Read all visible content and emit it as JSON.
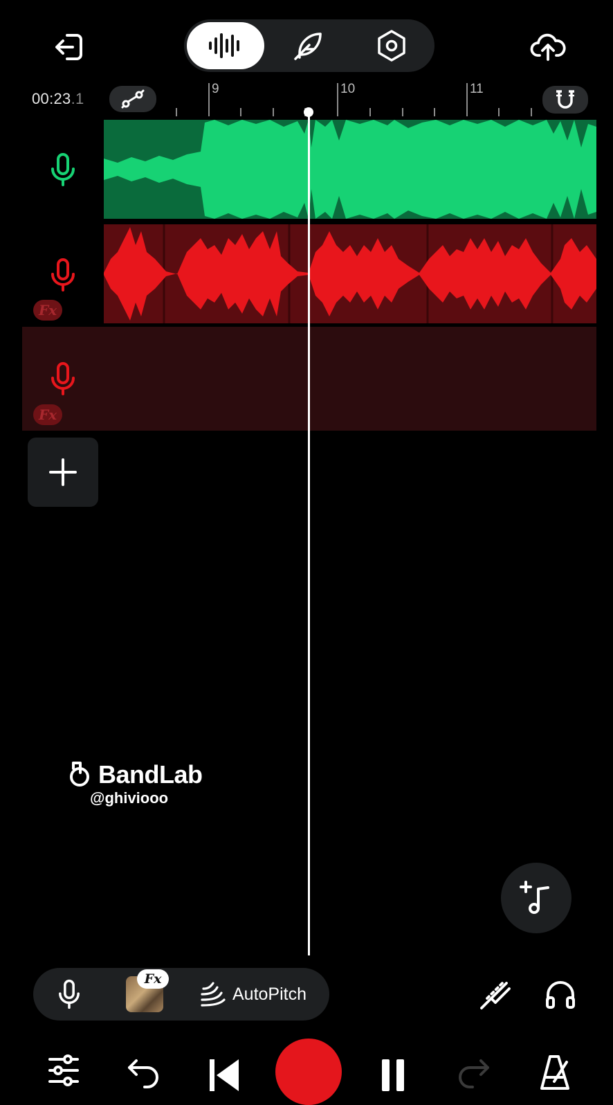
{
  "header": {
    "modes": [
      {
        "name": "tracks",
        "active": true
      },
      {
        "name": "edit",
        "active": false
      },
      {
        "name": "settings",
        "active": false
      }
    ]
  },
  "timeline": {
    "timecode_main": "00:23",
    "timecode_fraction": ".1",
    "bars": [
      "9",
      "10",
      "11"
    ]
  },
  "tracks": [
    {
      "type": "voice",
      "color": "#17d274",
      "fx": false
    },
    {
      "type": "voice",
      "color": "#e8161c",
      "fx": true,
      "fx_label": "Fx"
    },
    {
      "type": "voice",
      "color": "#e8161c",
      "fx": true,
      "fx_label": "Fx"
    }
  ],
  "watermark": {
    "brand": "BandLab",
    "handle": "@ghiviooo"
  },
  "bottom_bar": {
    "fx_label": "Fx",
    "autopitch_label": "AutoPitch"
  },
  "colors": {
    "accent_green": "#17d274",
    "accent_red": "#e8161c",
    "record": "#e4161c"
  }
}
